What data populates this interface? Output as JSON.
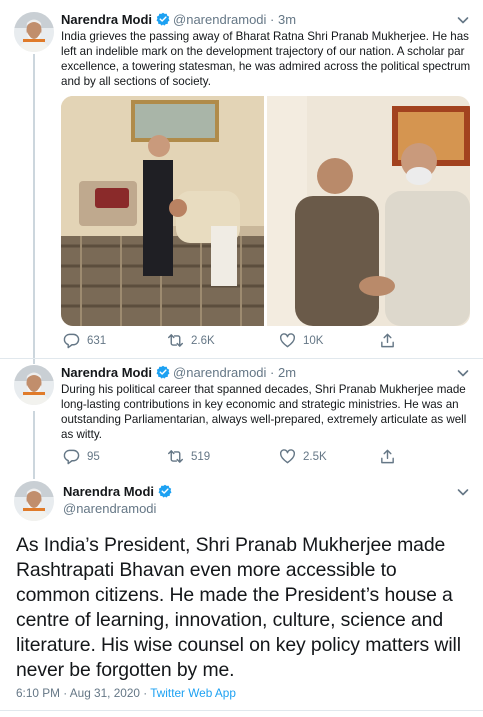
{
  "tweets": [
    {
      "name": "Narendra Modi",
      "handle": "@narendramodi",
      "time": "3m",
      "text": "India grieves the passing away of Bharat Ratna Shri Pranab Mukherjee. He has left an indelible mark on the development trajectory of our nation. A scholar par excellence, a towering statesman, he was admired across the political spectrum and by all sections of society.",
      "stats": {
        "replies": "631",
        "retweets": "2.6K",
        "likes": "10K"
      }
    },
    {
      "name": "Narendra Modi",
      "handle": "@narendramodi",
      "time": "2m",
      "text": "During his political career that spanned decades, Shri Pranab Mukherjee made long-lasting contributions in key economic and strategic ministries. He was an outstanding Parliamentarian, always well-prepared, extremely articulate as well as witty.",
      "stats": {
        "replies": "95",
        "retweets": "519",
        "likes": "2.5K"
      }
    },
    {
      "name": "Narendra Modi",
      "handle": "@narendramodi",
      "text": "As India’s President, Shri Pranab Mukherjee made Rashtrapati Bhavan even more accessible to common citizens. He made the President’s house a centre of learning, innovation, culture, science and literature. His wise counsel on key policy matters will never be forgotten by me.",
      "timestamp": "6:10 PM · Aug 31, 2020 · ",
      "source": "Twitter Web App"
    }
  ],
  "colors": {
    "brand": "#1da1f2",
    "muted": "#657786",
    "text": "#14171a",
    "border": "#e1e8ed"
  },
  "icons": [
    "verified-badge-icon",
    "chevron-down-icon",
    "reply-icon",
    "retweet-icon",
    "like-icon",
    "share-icon"
  ]
}
